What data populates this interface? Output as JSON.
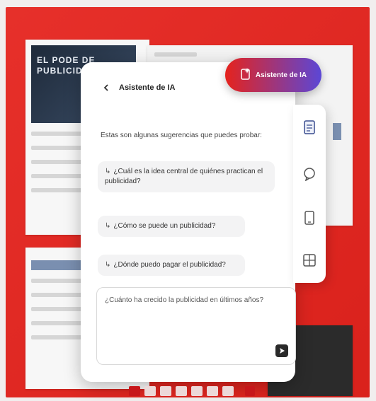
{
  "cover": {
    "title_lines": [
      "EL PODE DE",
      "PUBLICIDA"
    ]
  },
  "ai_button": {
    "label": "Asistente de IA",
    "bg_from": "#e5231d",
    "bg_to": "#5b47d6",
    "icon": "sparkle-document-icon"
  },
  "panel": {
    "title": "Asistente de IA",
    "back_icon": "chevron-left-icon",
    "intro": "Estas son algunas sugerencias que puedes probar:",
    "suggestions": [
      "¿Cuál es la idea central de quiénes practican el publicidad?",
      "¿Cómo se puede un publicidad?",
      "¿Dónde puedo pagar el publicidad?"
    ],
    "suggestion_arrow": "↳",
    "composer_placeholder": "¿Cuánto ha crecido la publicidad en últimos años?",
    "send_icon": "send-icon"
  },
  "rail": {
    "items": [
      {
        "icon": "document-icon"
      },
      {
        "icon": "chat-bubble-icon"
      },
      {
        "icon": "mobile-icon"
      },
      {
        "icon": "grid-layout-icon"
      }
    ]
  },
  "colors": {
    "frame": "#e5231d",
    "accent": "#c7161a"
  },
  "pagination": {
    "dot_count": 7,
    "active_index": 0
  }
}
